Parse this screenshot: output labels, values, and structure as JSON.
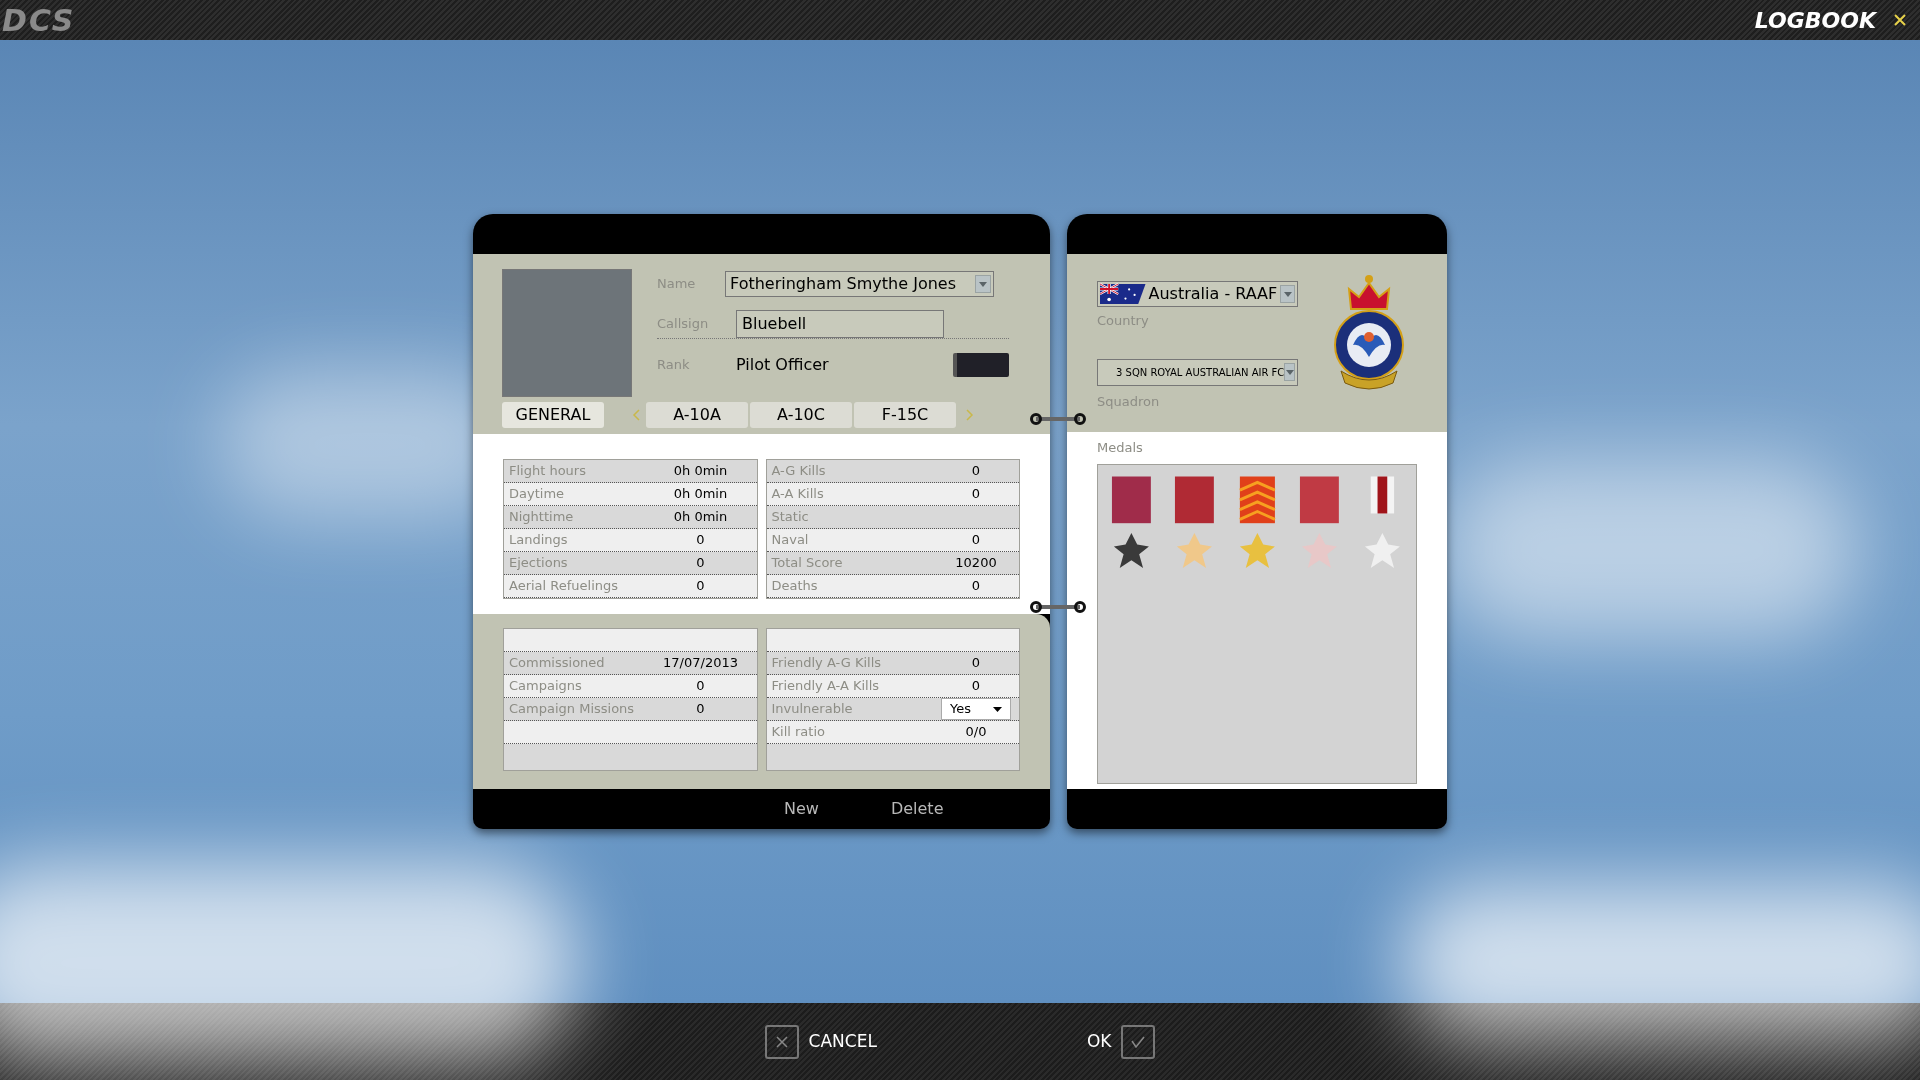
{
  "top_bar": {
    "logo": "DCS",
    "title": "LOGBOOK"
  },
  "pilot": {
    "name_label": "Name",
    "name": "Fotheringham Smythe Jones",
    "callsign_label": "Callsign",
    "callsign": "Bluebell",
    "rank_label": "Rank",
    "rank": "Pilot Officer"
  },
  "tabs": [
    {
      "label": "GENERAL",
      "selected": true
    },
    {
      "label": "A-10A",
      "selected": false
    },
    {
      "label": "A-10C",
      "selected": false
    },
    {
      "label": "F-15C",
      "selected": false
    }
  ],
  "stats_left": [
    {
      "label": "Flight hours",
      "value": "0h 0min"
    },
    {
      "label": "Daytime",
      "value": "0h 0min"
    },
    {
      "label": "Nighttime",
      "value": "0h 0min"
    },
    {
      "label": "Landings",
      "value": "0"
    },
    {
      "label": "Ejections",
      "value": "0"
    },
    {
      "label": "Aerial Refuelings",
      "value": "0"
    }
  ],
  "stats_right": [
    {
      "label": "A-G Kills",
      "value": "0"
    },
    {
      "label": "A-A Kills",
      "value": "0"
    },
    {
      "label": "Static"
    },
    {
      "label": "Naval",
      "value": "0"
    },
    {
      "label": "Total Score",
      "value": "10200"
    },
    {
      "label": "Deaths",
      "value": "0"
    }
  ],
  "career_left": [
    {
      "label": "Commissioned",
      "value": "17/07/2013"
    },
    {
      "label": "Campaigns",
      "value": "0"
    },
    {
      "label": "Campaign Missions",
      "value": "0"
    }
  ],
  "career_right": [
    {
      "kind": "text",
      "label": "Friendly A-G Kills",
      "value": "0"
    },
    {
      "kind": "text",
      "label": "Friendly A-A Kills",
      "value": "0"
    },
    {
      "kind": "dropdown",
      "label": "Invulnerable",
      "value": "Yes"
    },
    {
      "kind": "text",
      "label": "Kill ratio",
      "value": "0/0"
    }
  ],
  "footer_buttons": [
    "New",
    "Delete"
  ],
  "service": {
    "country": "Australia - RAAF",
    "country_label": "Country",
    "squadron": "3 SQN ROYAL AUSTRALIAN AIR FC",
    "squadron_label": "Squadron",
    "medals_label": "Medals"
  },
  "bottom_bar": {
    "cancel": "CANCEL",
    "ok": "OK"
  }
}
